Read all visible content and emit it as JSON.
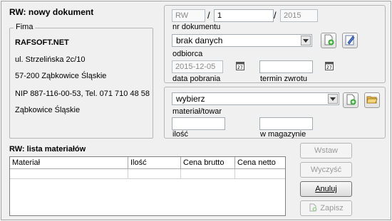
{
  "window": {
    "title": "RW: nowy dokument"
  },
  "company": {
    "group_label": "Fima",
    "name": "RAFSOFT.NET",
    "street": "ul. Strzelińska 2c/10",
    "city": "57-200 Ząbkowice Śląskie",
    "tax_phone": "NIP 887-116-00-53, Tel. 071 710 48 58",
    "town": "Ząbkowice Śląskie"
  },
  "document": {
    "nr_prefix": "RW",
    "nr_number": "1",
    "nr_year": "2015",
    "separator": "/",
    "nr_label": "nr dokumentu",
    "recipient_value": "brak danych",
    "recipient_label": "odbiorca",
    "date_value": "2015-12-05",
    "date_label": "data pobrania",
    "return_value": "",
    "return_label": "termin zwrotu"
  },
  "material": {
    "select_value": "wybierz",
    "select_label": "materiał/towar",
    "qty_value": "",
    "qty_label": "ilość",
    "stock_value": "",
    "stock_label": "w magazynie"
  },
  "list": {
    "title": "RW: lista materiałów",
    "columns": [
      "Materiał",
      "Ilość",
      "Cena brutto",
      "Cena netto"
    ]
  },
  "buttons": {
    "insert": "Wstaw",
    "clear": "Wyczyść",
    "cancel": "Anuluj",
    "save": "Zapisz"
  },
  "icons": {
    "add": "add-document-icon",
    "edit": "edit-pencil-icon",
    "calendar": "calendar-icon",
    "open": "open-folder-icon"
  }
}
